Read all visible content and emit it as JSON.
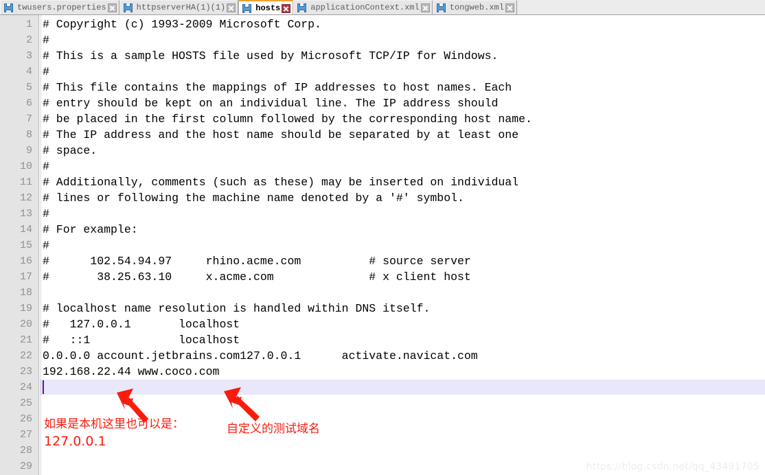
{
  "tabbar": {
    "tabs": [
      {
        "label": "twusers.properties",
        "icon": "floppy-disk-icon",
        "active": false,
        "close_icon": "close-icon"
      },
      {
        "label": "httpserverHA(1)(1)",
        "icon": "floppy-disk-icon",
        "active": false,
        "close_icon": "close-icon"
      },
      {
        "label": "hosts",
        "icon": "floppy-disk-icon",
        "active": true,
        "close_icon": "close-icon"
      },
      {
        "label": "applicationContext.xml",
        "icon": "floppy-disk-icon",
        "active": false,
        "close_icon": "close-icon"
      },
      {
        "label": "tongweb.xml",
        "icon": "floppy-disk-icon",
        "active": false,
        "close_icon": "close-icon"
      }
    ]
  },
  "editor": {
    "active_line": 24,
    "caret_line": 24,
    "colors": {
      "gutter_bg": "#e4e4e4",
      "gutter_fg": "#909090",
      "text": "#000000",
      "current_line_bg": "#e8e8fa",
      "caret": "#6a0dad",
      "annotation": "#fb1b0c",
      "active_tab_accent": "#f0a030"
    },
    "line_numbers": [
      1,
      2,
      3,
      4,
      5,
      6,
      7,
      8,
      9,
      10,
      11,
      12,
      13,
      14,
      15,
      16,
      17,
      18,
      19,
      20,
      21,
      22,
      23,
      24,
      25,
      26,
      27,
      28,
      29
    ],
    "lines": [
      "# Copyright (c) 1993-2009 Microsoft Corp.",
      "#",
      "# This is a sample HOSTS file used by Microsoft TCP/IP for Windows.",
      "#",
      "# This file contains the mappings of IP addresses to host names. Each",
      "# entry should be kept on an individual line. The IP address should",
      "# be placed in the first column followed by the corresponding host name.",
      "# The IP address and the host name should be separated by at least one",
      "# space.",
      "#",
      "# Additionally, comments (such as these) may be inserted on individual",
      "# lines or following the machine name denoted by a '#' symbol.",
      "#",
      "# For example:",
      "#",
      "#      102.54.94.97     rhino.acme.com          # source server",
      "#       38.25.63.10     x.acme.com              # x client host",
      "",
      "# localhost name resolution is handled within DNS itself.",
      "#   127.0.0.1       localhost",
      "#   ::1             localhost",
      "0.0.0.0 account.jetbrains.com127.0.0.1      activate.navicat.com",
      "192.168.22.44 www.coco.com",
      "",
      "",
      "",
      "",
      "",
      ""
    ]
  },
  "annotations": [
    {
      "text": "如果是本机这里也可以是：",
      "name": "annotation-localhost-note"
    },
    {
      "text": "127.0.0.1",
      "name": "annotation-localhost-ip"
    },
    {
      "text": "自定义的测试域名",
      "name": "annotation-custom-domain"
    }
  ],
  "watermark": {
    "text": "https://blog.csdn.net/qq_43491705"
  }
}
